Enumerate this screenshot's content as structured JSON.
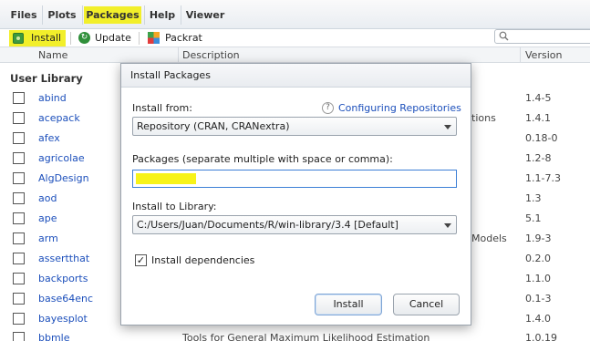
{
  "tabs": [
    "Files",
    "Plots",
    "Packages",
    "Help",
    "Viewer"
  ],
  "toolbar": {
    "install": "Install",
    "update": "Update",
    "packrat": "Packrat"
  },
  "columns": {
    "name": "Name",
    "description": "Description",
    "version": "Version"
  },
  "group": "User Library",
  "packages": [
    {
      "name": "abind",
      "desc": "",
      "ver": "1.4-5"
    },
    {
      "name": "acepack",
      "desc": "tions",
      "ver": "1.4.1"
    },
    {
      "name": "afex",
      "desc": "",
      "ver": "0.18-0"
    },
    {
      "name": "agricolae",
      "desc": "",
      "ver": "1.2-8"
    },
    {
      "name": "AlgDesign",
      "desc": "",
      "ver": "1.1-7.3"
    },
    {
      "name": "aod",
      "desc": "",
      "ver": "1.3"
    },
    {
      "name": "ape",
      "desc": "",
      "ver": "5.1"
    },
    {
      "name": "arm",
      "desc": "Models",
      "ver": "1.9-3"
    },
    {
      "name": "assertthat",
      "desc": "",
      "ver": "0.2.0"
    },
    {
      "name": "backports",
      "desc": "",
      "ver": "1.1.0"
    },
    {
      "name": "base64enc",
      "desc": "",
      "ver": "0.1-3"
    },
    {
      "name": "bayesplot",
      "desc": "",
      "ver": "1.4.0"
    },
    {
      "name": "bbmle",
      "desc": "Tools for General Maximum Likelihood Estimation",
      "ver": "1.0.19"
    }
  ],
  "dialog": {
    "title": "Install Packages",
    "install_from_label": "Install from:",
    "config_link": "Configuring Repositories",
    "install_from_value": "Repository (CRAN, CRANextra)",
    "packages_label": "Packages (separate multiple with space or comma):",
    "packages_value": "",
    "library_label": "Install to Library:",
    "library_value": "C:/Users/Juan/Documents/R/win-library/3.4 [Default]",
    "deps_label": "Install dependencies",
    "install_button": "Install",
    "cancel_button": "Cancel"
  },
  "colors": {
    "highlight": "#f2ef2a",
    "link": "#1c4fbb"
  },
  "icons": [
    "install-icon",
    "update-icon",
    "packrat-icon",
    "search-icon",
    "help-icon",
    "chevron-down-icon",
    "checkbox-icon"
  ]
}
